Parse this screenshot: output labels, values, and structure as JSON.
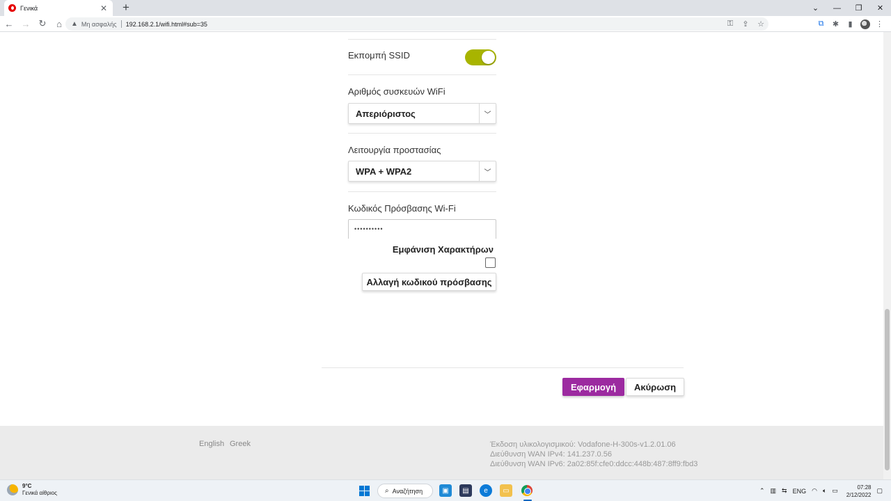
{
  "browser": {
    "tab_title": "Γενικά",
    "new_tab_symbol": "+",
    "security_label": "Μη ασφαλής",
    "url": "192.168.2.1/wifi.html#sub=35",
    "icons": [
      "back-icon",
      "forward-icon",
      "reload-icon",
      "home-icon",
      "warning-icon",
      "key-icon",
      "share-icon",
      "star-icon",
      "translate-icon",
      "extensions-icon",
      "side-panel-icon",
      "profile-avatar",
      "menu-icon"
    ]
  },
  "form": {
    "ssid_broadcast": {
      "label": "Εκπομπή SSID",
      "enabled": true,
      "color": "#a8b400"
    },
    "device_count": {
      "label": "Αριθμός συσκευών WiFi",
      "value": "Απεριόριστος"
    },
    "security_mode": {
      "label": "Λειτουργία προστασίας",
      "value": "WPA + WPA2"
    },
    "password": {
      "label": "Κωδικός Πρόσβασης Wi-Fi",
      "value": "••••••••••",
      "show_chars_label": "Εμφάνιση Χαρακτήρων",
      "show_chars_checked": false,
      "change_button": "Αλλαγή κωδικού πρόσβασης"
    }
  },
  "actions": {
    "apply": "Εφαρμογή",
    "cancel": "Ακύρωση",
    "apply_color": "#9c2aa0"
  },
  "footer": {
    "languages": [
      "English",
      "Greek"
    ],
    "firmware": "Έκδοση υλικολογισμικού: Vodafone-H-300s-v1.2.01.06",
    "wan_ipv4": "Διεύθυνση WAN IPv4: 141.237.0.56",
    "wan_ipv6": "Διεύθυνση WAN IPv6: 2a02:85f:cfe0:ddcc:448b:487:8ff9:fbd3"
  },
  "taskbar": {
    "weather_temp": "9°C",
    "weather_desc": "Γενικά αίθριος",
    "search_label": "Αναζήτηση",
    "language": "ENG",
    "time": "07:28",
    "date": "2/12/2022"
  }
}
